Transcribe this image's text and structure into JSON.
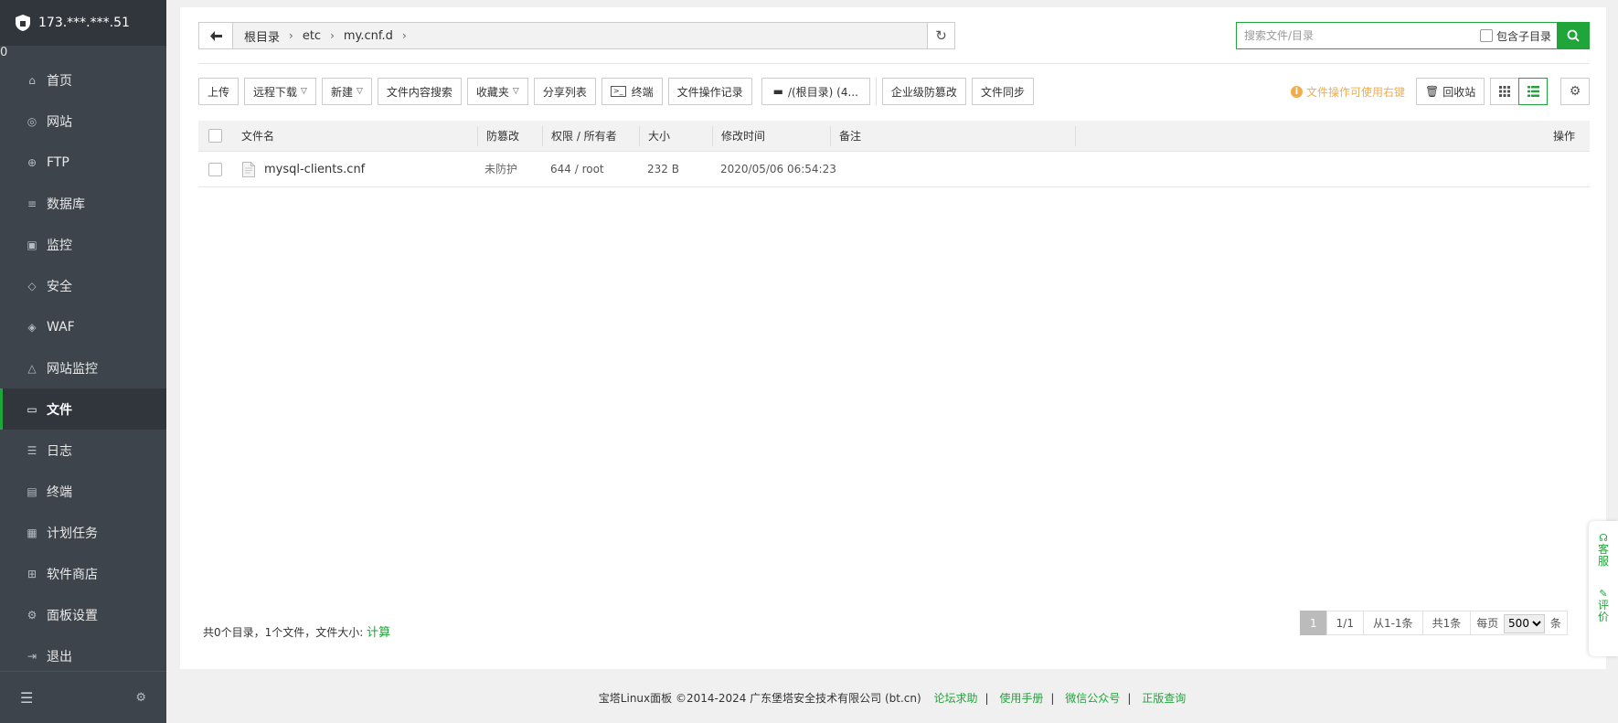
{
  "sidebar": {
    "ip": "173.***.***.51",
    "badge": "0",
    "items": [
      {
        "label": "首页",
        "icon": "home-icon"
      },
      {
        "label": "网站",
        "icon": "globe-icon"
      },
      {
        "label": "FTP",
        "icon": "ftp-icon"
      },
      {
        "label": "数据库",
        "icon": "database-icon"
      },
      {
        "label": "监控",
        "icon": "monitor-icon"
      },
      {
        "label": "安全",
        "icon": "shield-icon"
      },
      {
        "label": "WAF",
        "icon": "waf-icon"
      },
      {
        "label": "网站监控",
        "icon": "site-monitor-icon"
      },
      {
        "label": "文件",
        "icon": "folder-icon",
        "active": true
      },
      {
        "label": "日志",
        "icon": "log-icon"
      },
      {
        "label": "终端",
        "icon": "terminal-icon"
      },
      {
        "label": "计划任务",
        "icon": "calendar-icon"
      },
      {
        "label": "软件商店",
        "icon": "apps-icon"
      },
      {
        "label": "面板设置",
        "icon": "settings-icon"
      },
      {
        "label": "退出",
        "icon": "logout-icon"
      }
    ]
  },
  "path": {
    "crumbs": [
      "根目录",
      "etc",
      "my.cnf.d"
    ]
  },
  "search": {
    "placeholder": "搜索文件/目录",
    "include_sub": "包含子目录"
  },
  "toolbar": {
    "upload": "上传",
    "remote_download": "远程下载",
    "new": "新建",
    "content_search": "文件内容搜索",
    "favorites": "收藏夹",
    "share_list": "分享列表",
    "terminal": "终端",
    "op_log": "文件操作记录",
    "disk": "/(根目录) (4...",
    "tamper": "企业级防篡改",
    "sync": "文件同步",
    "hint": "文件操作可使用右键",
    "recycle": "回收站"
  },
  "table": {
    "headers": {
      "name": "文件名",
      "protect": "防篡改",
      "perm": "权限 / 所有者",
      "size": "大小",
      "mtime": "修改时间",
      "remark": "备注",
      "ops": "操作"
    },
    "rows": [
      {
        "name": "mysql-clients.cnf",
        "protect": "未防护",
        "perm": "644 / root",
        "size": "232 B",
        "mtime": "2020/05/06 06:54:23",
        "remark": ""
      }
    ]
  },
  "footer_stats": {
    "text": "共0个目录，1个文件，文件大小:",
    "calc": "计算"
  },
  "pager": {
    "current": "1",
    "pages": "1/1",
    "range": "从1-1条",
    "total": "共1条",
    "per_page_label": "每页",
    "per_page": "500",
    "unit": "条"
  },
  "site_footer": {
    "copyright": "宝塔Linux面板 ©2014-2024 广东堡塔安全技术有限公司 (bt.cn)",
    "links": [
      "论坛求助",
      "使用手册",
      "微信公众号",
      "正版查询"
    ]
  },
  "float": {
    "service": "客服",
    "review": "评价"
  },
  "colors": {
    "accent": "#20a53a",
    "sidebar_bg": "#3e444b",
    "hint": "#f0ad4e",
    "badge": "#f0772d"
  }
}
